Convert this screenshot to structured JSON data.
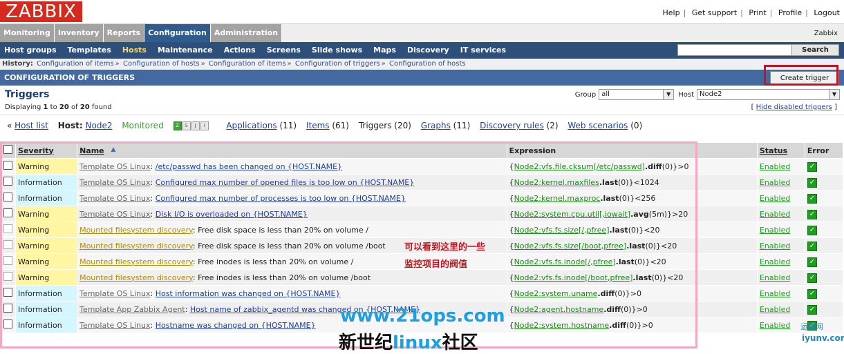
{
  "logo": "ZABBIX",
  "toplinks": [
    "Help",
    "Get support",
    "Print",
    "Profile",
    "Logout"
  ],
  "mainmenu": {
    "tabs": [
      "Monitoring",
      "Inventory",
      "Reports",
      "Configuration",
      "Administration"
    ],
    "active": "Configuration",
    "user": "Zabbix"
  },
  "submenu": {
    "items": [
      "Host groups",
      "Templates",
      "Hosts",
      "Maintenance",
      "Actions",
      "Screens",
      "Slide shows",
      "Maps",
      "Discovery",
      "IT services"
    ],
    "active": "Hosts",
    "search_button": "Search"
  },
  "history": {
    "label": "History:",
    "items": [
      "Configuration of items",
      "Configuration of hosts",
      "Configuration of items",
      "Configuration of triggers",
      "Configuration of hosts"
    ]
  },
  "section_title": "CONFIGURATION OF TRIGGERS",
  "create_button": "Create trigger",
  "triggers_title": "Triggers",
  "filters": {
    "group_label": "Group",
    "group_value": "all",
    "host_label": "Host",
    "host_value": "Node2"
  },
  "displaying": {
    "prefix": "Displaying",
    "from": "1",
    "to_word": "to",
    "to": "20",
    "of_word": "of",
    "total": "20",
    "suffix": "found"
  },
  "hide_disabled": "Hide disabled triggers",
  "hostnav": {
    "host_list": "Host list",
    "host_label": "Host:",
    "host_name": "Node2",
    "monitored": "Monitored",
    "icons": [
      "Z",
      "S",
      "J",
      "I"
    ],
    "applications": "Applications",
    "applications_count": "(11)",
    "items": "Items",
    "items_count": "(61)",
    "triggers": "Triggers",
    "triggers_count": "(20)",
    "graphs": "Graphs",
    "graphs_count": "(11)",
    "discovery": "Discovery rules",
    "discovery_count": "(2)",
    "web": "Web scenarios",
    "web_count": "(0)"
  },
  "table": {
    "headers": {
      "severity": "Severity",
      "name": "Name",
      "sort_arrow": "▲",
      "expression": "Expression",
      "status": "Status",
      "error": "Error"
    },
    "rows": [
      {
        "severity": "Warning",
        "sev": "warning",
        "source": "Template OS Linux",
        "source_type": "template",
        "name": "/etc/passwd has been changed on {HOST.NAME}",
        "expr_open": "{",
        "expr_item": "Node2:vfs.file.cksum[/etc/passwd]",
        "expr_func": ".diff",
        "expr_rest": "(0)}>0",
        "status": "Enabled",
        "cb_disabled": false
      },
      {
        "severity": "Information",
        "sev": "information",
        "source": "Template OS Linux",
        "source_type": "template",
        "name": "Configured max number of opened files is too low on {HOST.NAME}",
        "expr_open": "{",
        "expr_item": "Node2:kernel.maxfiles",
        "expr_func": ".last",
        "expr_rest": "(0)}<1024",
        "status": "Enabled",
        "cb_disabled": false
      },
      {
        "severity": "Information",
        "sev": "information",
        "source": "Template OS Linux",
        "source_type": "template",
        "name": "Configured max number of processes is too low on {HOST.NAME}",
        "expr_open": "{",
        "expr_item": "Node2:kernel.maxproc",
        "expr_func": ".last",
        "expr_rest": "(0)}<256",
        "status": "Enabled",
        "cb_disabled": false
      },
      {
        "severity": "Warning",
        "sev": "warning",
        "source": "Template OS Linux",
        "source_type": "template",
        "name": "Disk I/O is overloaded on {HOST.NAME}",
        "expr_open": "{",
        "expr_item": "Node2:system.cpu.util[,iowait]",
        "expr_func": ".avg",
        "expr_rest": "(5m)}>20",
        "status": "Enabled",
        "cb_disabled": false
      },
      {
        "severity": "Warning",
        "sev": "warning",
        "source": "Mounted filesystem discovery",
        "source_type": "discovery",
        "name": ": Free disk space is less than 20% on volume /",
        "expr_open": "{",
        "expr_item": "Node2:vfs.fs.size[/,pfree]",
        "expr_func": ".last",
        "expr_rest": "(0)}<20",
        "status": "Enabled",
        "cb_disabled": true
      },
      {
        "severity": "Warning",
        "sev": "warning",
        "source": "Mounted filesystem discovery",
        "source_type": "discovery",
        "name": ": Free disk space is less than 20% on volume /boot",
        "expr_open": "{",
        "expr_item": "Node2:vfs.fs.size[/boot,pfree]",
        "expr_func": ".last",
        "expr_rest": "(0)}<20",
        "status": "Enabled",
        "cb_disabled": true
      },
      {
        "severity": "Warning",
        "sev": "warning",
        "source": "Mounted filesystem discovery",
        "source_type": "discovery",
        "name": ": Free inodes is less than 20% on volume /",
        "expr_open": "{",
        "expr_item": "Node2:vfs.fs.inode[/,pfree]",
        "expr_func": ".last",
        "expr_rest": "(0)}<20",
        "status": "Enabled",
        "cb_disabled": true
      },
      {
        "severity": "Warning",
        "sev": "warning",
        "source": "Mounted filesystem discovery",
        "source_type": "discovery",
        "name": ": Free inodes is less than 20% on volume /boot",
        "expr_open": "{",
        "expr_item": "Node2:vfs.fs.inode[/boot,pfree]",
        "expr_func": ".last",
        "expr_rest": "(0)}<20",
        "status": "Enabled",
        "cb_disabled": true
      },
      {
        "severity": "Information",
        "sev": "information",
        "source": "Template OS Linux",
        "source_type": "template",
        "name": "Host information was changed on {HOST.NAME}",
        "expr_open": "{",
        "expr_item": "Node2:system.uname",
        "expr_func": ".diff",
        "expr_rest": "(0)}>0",
        "status": "Enabled",
        "cb_disabled": false
      },
      {
        "severity": "Information",
        "sev": "information",
        "source": "Template App Zabbix Agent",
        "source_type": "template",
        "name": "Host name of zabbix_agentd was changed on {HOST.NAME}",
        "expr_open": "{",
        "expr_item": "Node2:agent.hostname",
        "expr_func": ".diff",
        "expr_rest": "(0)}>0",
        "status": "Enabled",
        "cb_disabled": false
      },
      {
        "severity": "Information",
        "sev": "information",
        "source": "Template OS Linux",
        "source_type": "template",
        "name": "Hostname was changed on {HOST.NAME}",
        "expr_open": "{",
        "expr_item": "Node2:system.hostname",
        "expr_func": ".diff",
        "expr_rest": "(0)}>0",
        "status": "Enabled",
        "cb_disabled": false
      }
    ]
  },
  "annotation": [
    "可以看到这里的一些",
    "监控项目的阀值"
  ],
  "watermarks": {
    "url": "www.21ops.com",
    "cn_left": "新世纪",
    "cn_mid": "linux",
    "cn_right": "社区",
    "corner_top": "运维网",
    "corner_bottom": "iyunv.com"
  },
  "colors": {
    "logo_red": "#d52b1e",
    "active_tab": "#2f5c8e",
    "submenu_bg": "#2f4f7b",
    "section_bg": "#4468a0",
    "warning_bg": "#fff5a3",
    "information_bg": "#d6f6ff",
    "enabled_green": "#1aa51a"
  }
}
